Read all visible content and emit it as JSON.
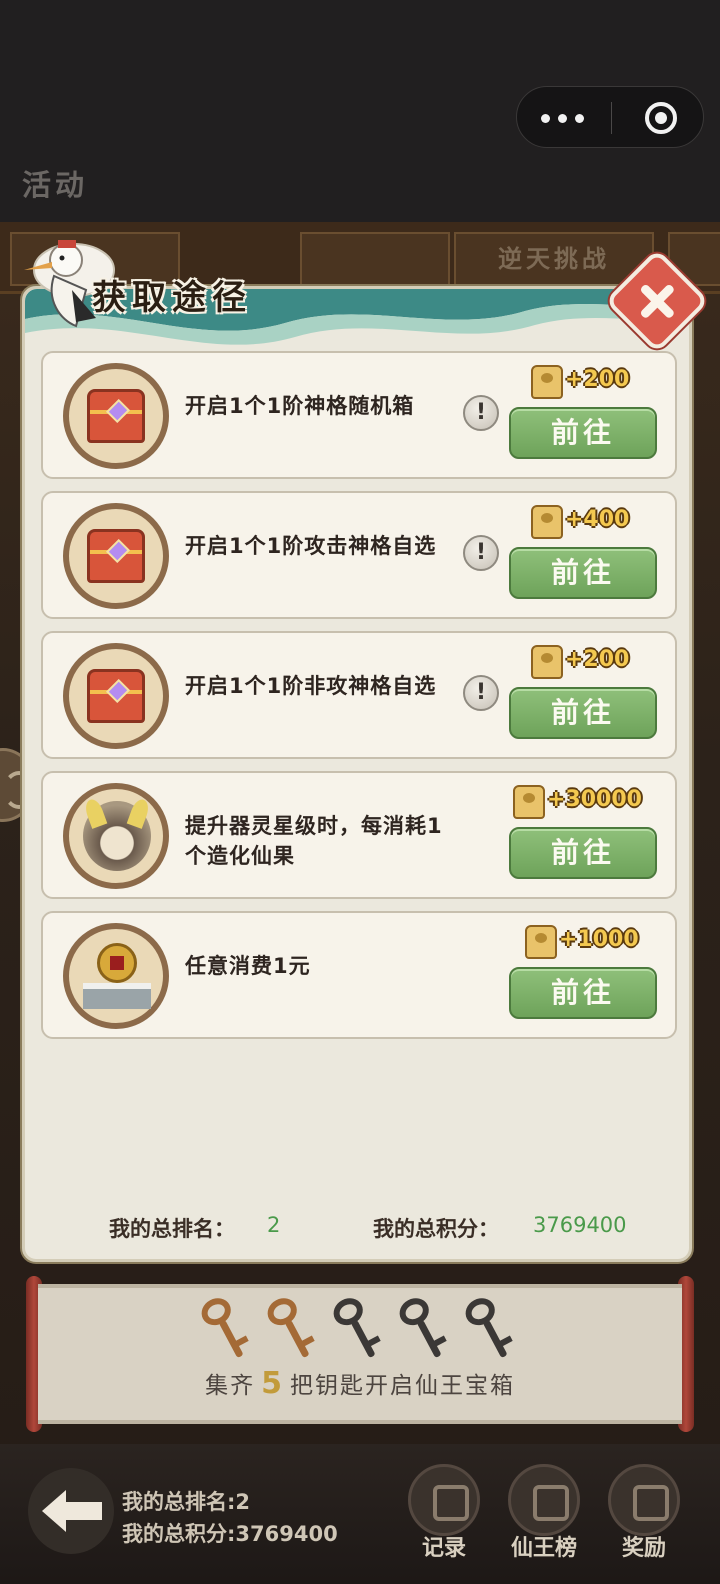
{
  "app": {
    "title": "活动"
  },
  "background_tabs": [
    "逆天挑战"
  ],
  "modal": {
    "title": "获取途径",
    "items": [
      {
        "text": "开启1个1阶神格随机箱",
        "icon": "treasure-chest-icon",
        "has_info": true,
        "reward": "+200",
        "button": "前往"
      },
      {
        "text": "开启1个1阶攻击神格自选",
        "icon": "treasure-chest-icon",
        "has_info": true,
        "reward": "+400",
        "button": "前往"
      },
      {
        "text": "开启1个1阶非攻神格自选",
        "icon": "treasure-chest-icon",
        "has_info": true,
        "reward": "+200",
        "button": "前往"
      },
      {
        "text": "提升器灵星级时，每消耗1个造化仙果",
        "icon": "spirit-orb-icon",
        "has_info": false,
        "reward": "+30000",
        "button": "前往"
      },
      {
        "text": "任意消费1元",
        "icon": "shrine-coin-icon",
        "has_info": false,
        "reward": "+1000",
        "button": "前往"
      }
    ],
    "stats": {
      "rank_label": "我的总排名：",
      "rank_value": "2",
      "score_label": "我的总积分：",
      "score_value": "3769400"
    }
  },
  "keys": {
    "collected": 2,
    "total": 5,
    "text_before": "集齐",
    "count": "5",
    "text_after": "把钥匙开启仙王宝箱"
  },
  "bottom": {
    "rank": "我的总排名:2",
    "score": "我的总积分:3769400",
    "buttons": [
      "记录",
      "仙王榜",
      "奖励"
    ]
  },
  "colors": {
    "go_button": "#7bb066",
    "close_button": "#d95a4c",
    "stat_value": "#4a9a4a",
    "reward_text": "#f4c950"
  }
}
